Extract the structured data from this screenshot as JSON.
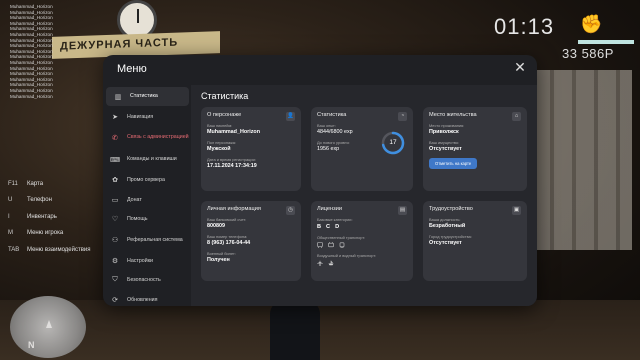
{
  "hud": {
    "chat_lines": [
      "Muhammad_Horizon",
      "Muhammad_Horizon",
      "Muhammad_Horizon",
      "Muhammad_Horizon",
      "Muhammad_Horizon",
      "Muhammad_Horizon",
      "Muhammad_Horizon",
      "Muhammad_Horizon",
      "Muhammad_Horizon",
      "Muhammad_Horizon",
      "Muhammad_Horizon",
      "Muhammad_Horizon",
      "Muhammad_Horizon",
      "Muhammad_Horizon",
      "Muhammad_Horizon",
      "Muhammad_Horizon",
      "Muhammad_Horizon"
    ],
    "time": "01:13",
    "money": "33 586Р",
    "minimap_north": "N",
    "background_sign": "ДЕЖУРНАЯ ЧАСТЬ"
  },
  "hotkeys": [
    {
      "key": "F11",
      "label": "Карта"
    },
    {
      "key": "U",
      "label": "Телефон"
    },
    {
      "key": "I",
      "label": "Инвентарь"
    },
    {
      "key": "M",
      "label": "Меню игрока"
    },
    {
      "key": "TAB",
      "label": "Меню взаимодействия"
    }
  ],
  "modal": {
    "title": "Меню",
    "close_icon": "close-icon",
    "nav": [
      {
        "label": "Статистика",
        "icon": "stats-icon",
        "active": true
      },
      {
        "label": "Навигация",
        "icon": "navigation-icon"
      },
      {
        "label": "Связь с администрацией",
        "icon": "support-icon",
        "danger": true
      },
      {
        "label": "Команды и клавиши",
        "icon": "keyboard-icon"
      },
      {
        "label": "Промо сервера",
        "icon": "promo-icon"
      },
      {
        "label": "Донат",
        "icon": "donate-icon"
      },
      {
        "label": "Помощь",
        "icon": "help-icon"
      },
      {
        "label": "Реферальная система",
        "icon": "referral-icon"
      },
      {
        "label": "Настройки",
        "icon": "settings-icon"
      },
      {
        "label": "Безопасность",
        "icon": "security-icon"
      },
      {
        "label": "Обновления",
        "icon": "updates-icon"
      }
    ],
    "section_title": "Статистика",
    "cards": {
      "about": {
        "title": "О персонаже",
        "nick_label": "Ваш никнейм:",
        "nick": "Muhammad_Horizon",
        "gender_label": "Пол персонажа:",
        "gender": "Мужской",
        "reg_label": "Дата и время регистрации:",
        "reg": "17.11.2024 17:34:19"
      },
      "stats": {
        "title": "Статистика",
        "exp_label": "Ваш опыт:",
        "exp": "4844/6800 exp",
        "next_label": "До нового уровня:",
        "next": "1956 exp",
        "level": "17",
        "progress": 0.712
      },
      "residence": {
        "title": "Место жительства",
        "place_label": "Место проживания:",
        "place": "Приволжск",
        "property_label": "Ваш имущество:",
        "property": "Отсутствует",
        "button": "Отметить на карте"
      },
      "personal": {
        "title": "Личная информация",
        "account_label": "Ваш банковский счет:",
        "account": "800809",
        "phone_label": "Ваш номер телефона:",
        "phone": "8 (963) 176-04-44",
        "military_label": "Военный билет:",
        "military": "Получен"
      },
      "licenses": {
        "title": "Лицензии",
        "base_label": "Базовые категории:",
        "categories": [
          "B",
          "C",
          "D"
        ],
        "public_label": "Общественный транспорт:",
        "air_label": "Воздушный и водный транспорт:"
      },
      "employment": {
        "title": "Трудоустройство",
        "job_label": "Ваша должность:",
        "job": "Безработный",
        "org_label": "Город трудоустройства:",
        "org": "Отсутствует"
      }
    }
  },
  "colors": {
    "accent_blue": "#3f78c8",
    "danger": "#e46a72",
    "modal_bg": "#1f2024",
    "card_bg": "#35363c"
  }
}
